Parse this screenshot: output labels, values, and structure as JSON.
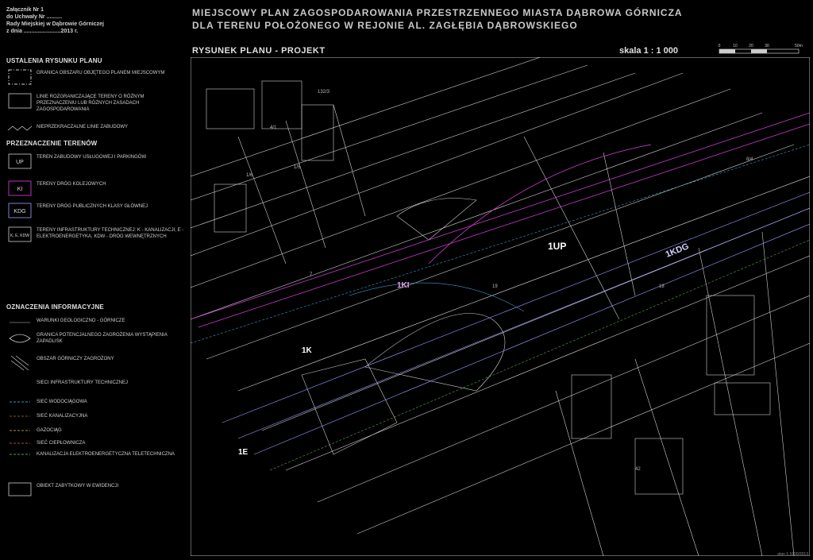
{
  "legend": {
    "attachment": [
      "Załącznik Nr 1",
      "do Uchwały Nr ..........",
      "Rady Miejskiej w Dąbrowie Górniczej",
      "z dnia ........................2013 r."
    ],
    "section_plan": "USTALENIA RYSUNKU PLANU",
    "plan_items": [
      {
        "icon": "plan-boundary-icon",
        "text": "GRANICA OBSZARU OBJĘTEGO PLANEM MIEJSCOWYM"
      },
      {
        "icon": "zone-boundary-icon",
        "text": "LINIE ROZGRANICZAJĄCE TERENY O RÓŻNYM PRZEZNACZENIU LUB RÓŻNYCH ZASADACH ZAGOSPODAROWANIA"
      },
      {
        "icon": "building-line-icon",
        "text": "NIEPRZEKRACZALNE LINIE ZABUDOWY"
      }
    ],
    "section_zones": "PRZEZNACZENIE TERENÓW",
    "zone_items": [
      {
        "code": "UP",
        "text": "TEREN ZABUDOWY USŁUGOWEJ I PARKINGÓW"
      },
      {
        "code": "KI",
        "text": "TERENY DRÓG KOLEJOWYCH"
      },
      {
        "code": "KDG",
        "text": "TERENY DRÓG PUBLICZNYCH KLASY GŁÓWNEJ"
      },
      {
        "code": "K, E, KDW",
        "text": "TERENY INFRASTRUKTURY TECHNICZNEJ: K - KANALIZACJI, E - ELEKTROENERGETYKA, KDW - DRÓG WEWNĘTRZNYCH"
      }
    ],
    "section_info": "OZNACZENIA INFORMACYJNE",
    "info_items": [
      {
        "icon": "mining-area-icon",
        "text": "WARUNKI GEOLOGICZNO - GÓRNICZE"
      },
      {
        "icon": "subsidence-icon",
        "text": "GRANICA POTENCJALNEGO ZAGROŻENIA WYSTĄPIENIA ZAPADLISK"
      },
      {
        "icon": "landslide-icon",
        "text": "OBSZAR GÓRNICZY ZAGROŻONY"
      },
      {
        "icon": "infra-title-icon",
        "text": "SIECI INFRASTRUKTURY TECHNICZNEJ"
      },
      {
        "icon": "water-line-icon",
        "text": "SIEĆ WODOCIĄGOWA"
      },
      {
        "icon": "sewer-line-icon",
        "text": "SIEĆ KANALIZACYJNA"
      },
      {
        "icon": "gas-line-icon",
        "text": "GAZOCIĄG"
      },
      {
        "icon": "heat-line-icon",
        "text": "SIEĆ CIEPŁOWNICZA"
      },
      {
        "icon": "power-line-icon",
        "text": "KANALIZACJA ELEKTROENERGETYCZNA TELETECHNICZNA"
      },
      {
        "icon": "monument-icon",
        "text": "OBIEKT ZABYTKOWY W EWIDENCJI"
      }
    ]
  },
  "header": {
    "title_line1": "MIEJSCOWY PLAN ZAGOSPODAROWANIA PRZESTRZENNEGO MIASTA DĄBROWA GÓRNICZA",
    "title_line2": "DLA TERENU POŁOŻONEGO W REJONIE AL. ZAGŁĘBIA DĄBROWSKIEGO",
    "subtitle": "RYSUNEK PLANU - PROJEKT",
    "scale": "skala 1 : 1 000"
  },
  "map": {
    "labels": {
      "up": "1UP",
      "kdg": "1KDG",
      "ki": "1KI",
      "k1": "1K",
      "k2": "1E",
      "p1": "132/3",
      "p2": "4/1",
      "p3": "1/6",
      "p4": "1/5",
      "p5": "18",
      "p6": "19",
      "p7": "8/4",
      "p8": "42",
      "p9": "7"
    },
    "colors": {
      "rail": "#e040e0",
      "road": "#9aa0ff",
      "lines": "#cfcfcf",
      "water": "#50c0ff",
      "green": "#60e060"
    }
  },
  "scalebar": [
    "0",
    "10",
    "20",
    "30",
    "50m"
  ],
  "stamp": "plan 1:1000/2013"
}
